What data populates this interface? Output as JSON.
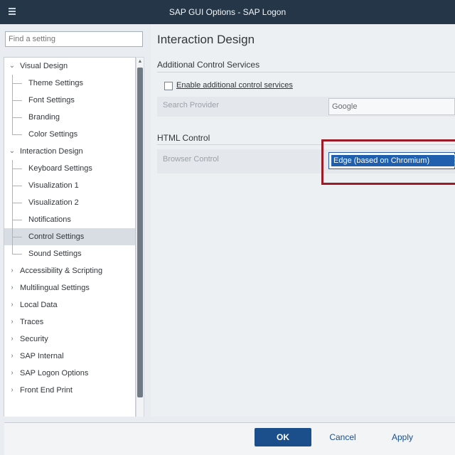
{
  "window": {
    "title": "SAP GUI Options - SAP Logon",
    "menu_icon": "hamburger-menu-icon"
  },
  "search": {
    "placeholder": "Find a setting"
  },
  "tree": {
    "items": [
      {
        "label": "Visual Design",
        "level": 0,
        "expanded": true
      },
      {
        "label": "Theme Settings",
        "level": 1
      },
      {
        "label": "Font Settings",
        "level": 1
      },
      {
        "label": "Branding",
        "level": 1
      },
      {
        "label": "Color Settings",
        "level": 1
      },
      {
        "label": "Interaction Design",
        "level": 0,
        "expanded": true
      },
      {
        "label": "Keyboard Settings",
        "level": 1
      },
      {
        "label": "Visualization 1",
        "level": 1
      },
      {
        "label": "Visualization 2",
        "level": 1
      },
      {
        "label": "Notifications",
        "level": 1
      },
      {
        "label": "Control Settings",
        "level": 1,
        "selected": true
      },
      {
        "label": "Sound Settings",
        "level": 1
      },
      {
        "label": "Accessibility & Scripting",
        "level": 0,
        "expanded": false
      },
      {
        "label": "Multilingual Settings",
        "level": 0,
        "expanded": false
      },
      {
        "label": "Local Data",
        "level": 0,
        "expanded": false
      },
      {
        "label": "Traces",
        "level": 0,
        "expanded": false
      },
      {
        "label": "Security",
        "level": 0,
        "expanded": false
      },
      {
        "label": "SAP Internal",
        "level": 0,
        "expanded": false
      },
      {
        "label": "SAP Logon Options",
        "level": 0,
        "expanded": false
      },
      {
        "label": "Front End Print",
        "level": 0,
        "expanded": false
      }
    ]
  },
  "main": {
    "title": "Interaction Design",
    "section_additional": "Additional Control Services",
    "checkbox_label": "Enable additional control services",
    "checkbox_checked": false,
    "search_provider_label": "Search Provider",
    "search_provider_value": "Google",
    "section_html": "HTML Control",
    "browser_control_label": "Browser Control",
    "browser_control_value": "Edge (based on Chromium)",
    "highlight_color": "#9b1c26"
  },
  "footer": {
    "ok_label": "OK",
    "cancel_label": "Cancel",
    "apply_label": "Apply"
  },
  "colors": {
    "titlebar": "#243648",
    "accent": "#1a4f8b"
  }
}
